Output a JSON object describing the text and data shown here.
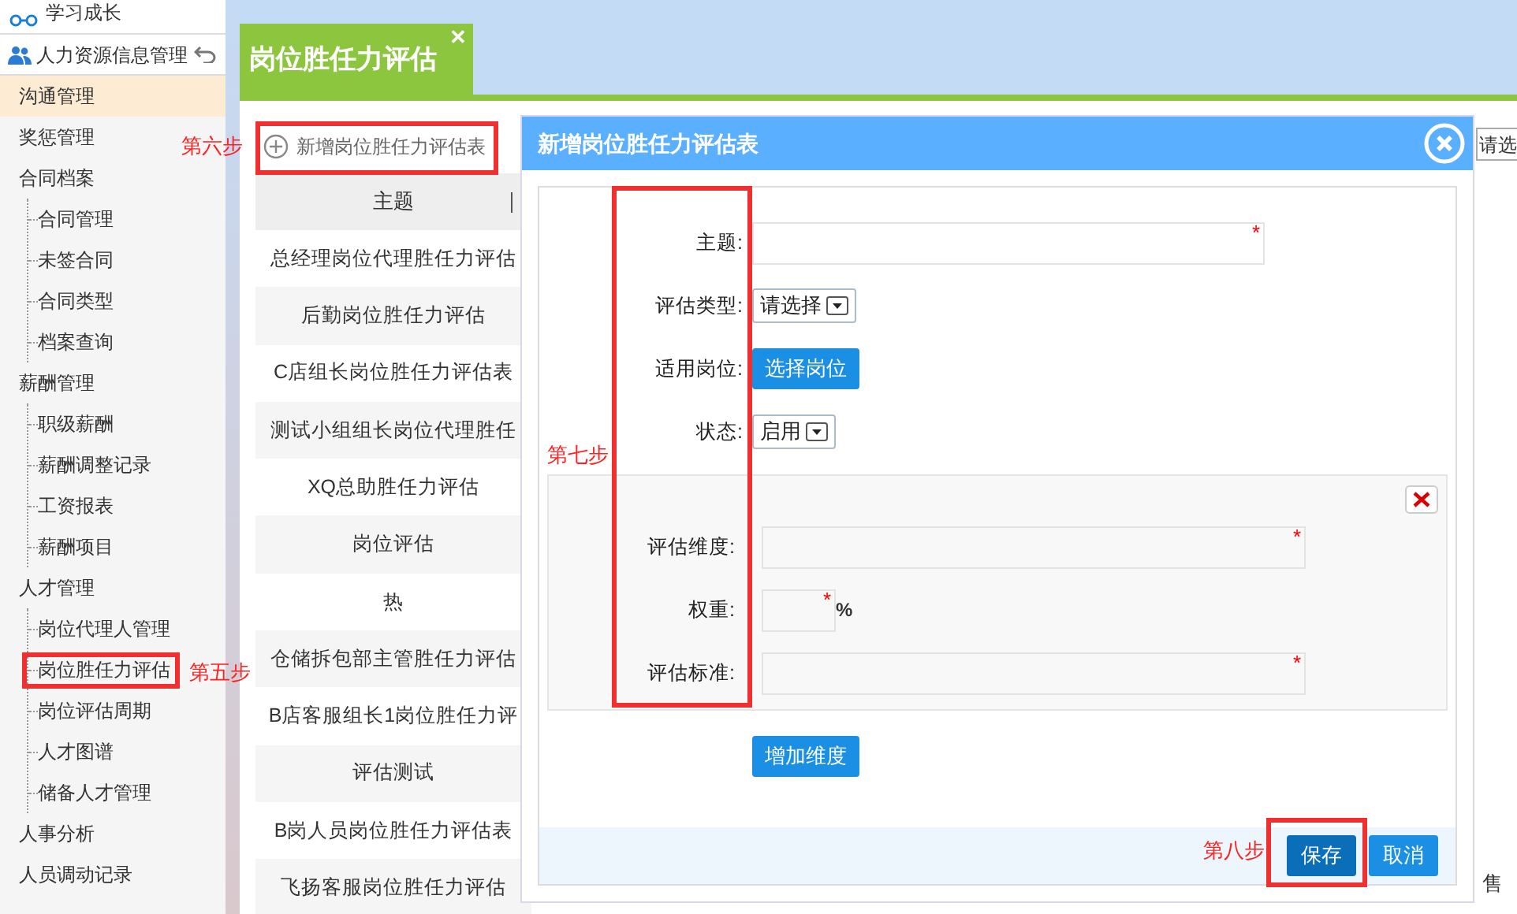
{
  "sidebar": {
    "top_items": [
      {
        "label": "学习成长",
        "kind": "glasses"
      }
    ],
    "module": {
      "label": "人力资源信息管理"
    },
    "items": [
      {
        "label": "沟通管理",
        "selected": true
      },
      {
        "label": "奖惩管理",
        "selected": false
      },
      {
        "label": "合同档案",
        "selected": false,
        "children": [
          {
            "label": "合同管理",
            "selected": false
          },
          {
            "label": "未签合同",
            "selected": false
          },
          {
            "label": "合同类型",
            "selected": false
          },
          {
            "label": "档案查询",
            "selected": false
          }
        ]
      },
      {
        "label": "薪酬管理",
        "selected": false,
        "children": [
          {
            "label": "职级薪酬",
            "selected": false
          },
          {
            "label": "薪酬调整记录",
            "selected": false
          },
          {
            "label": "工资报表",
            "selected": false
          },
          {
            "label": "薪酬项目",
            "selected": false
          }
        ]
      },
      {
        "label": "人才管理",
        "selected": false,
        "children": [
          {
            "label": "岗位代理人管理",
            "selected": false
          },
          {
            "label": "岗位胜任力评估",
            "selected": false
          },
          {
            "label": "岗位评估周期",
            "selected": false
          },
          {
            "label": "人才图谱",
            "selected": false
          },
          {
            "label": "储备人才管理",
            "selected": false
          }
        ]
      },
      {
        "label": "人事分析",
        "selected": false
      },
      {
        "label": "人员调动记录",
        "selected": false
      }
    ]
  },
  "tab": {
    "title": "岗位胜任力评估",
    "close": "✕"
  },
  "toolbar": {
    "add_button": "新增岗位胜任力评估表"
  },
  "table": {
    "columns": [
      "主题"
    ],
    "rows": [
      "总经理岗位代理胜任力评估",
      "后勤岗位胜任力评估",
      "C店组长岗位胜任力评估表",
      "测试小组组长岗位代理胜任",
      "XQ总助胜任力评估",
      "岗位评估",
      "热",
      "仓储拆包部主管胜任力评估",
      "B店客服组长1岗位胜任力评",
      "评估测试",
      "B岗人员岗位胜任力评估表",
      "飞扬客服岗位胜任力评估"
    ]
  },
  "background_right": {
    "select_button": "请选",
    "cell_text": "售"
  },
  "dialog": {
    "title": "新增岗位胜任力评估表",
    "fields": [
      {
        "label": "主题:",
        "kind": "text",
        "required_mark": "*"
      },
      {
        "label": "评估类型:",
        "kind": "select",
        "value": "请选择"
      },
      {
        "label": "适用岗位:",
        "kind": "button",
        "value": "选择岗位"
      },
      {
        "label": "状态:",
        "kind": "select",
        "value": "启用"
      }
    ],
    "dimension": {
      "fields": [
        {
          "label": "评估维度:",
          "kind": "text",
          "required_mark": "*"
        },
        {
          "label": "权重:",
          "kind": "number",
          "required_mark": "*",
          "suffix": "%"
        },
        {
          "label": "评估标准:",
          "kind": "text",
          "required_mark": "*"
        }
      ]
    },
    "add_dimension_button": "增加维度",
    "buttons": [
      {
        "label": "保存",
        "kind": "primary"
      },
      {
        "label": "取消",
        "kind": "default"
      }
    ]
  },
  "annotations": [
    {
      "text": "第六步"
    },
    {
      "text": "第五步"
    },
    {
      "text": "第七步"
    },
    {
      "text": "第八步"
    }
  ]
}
